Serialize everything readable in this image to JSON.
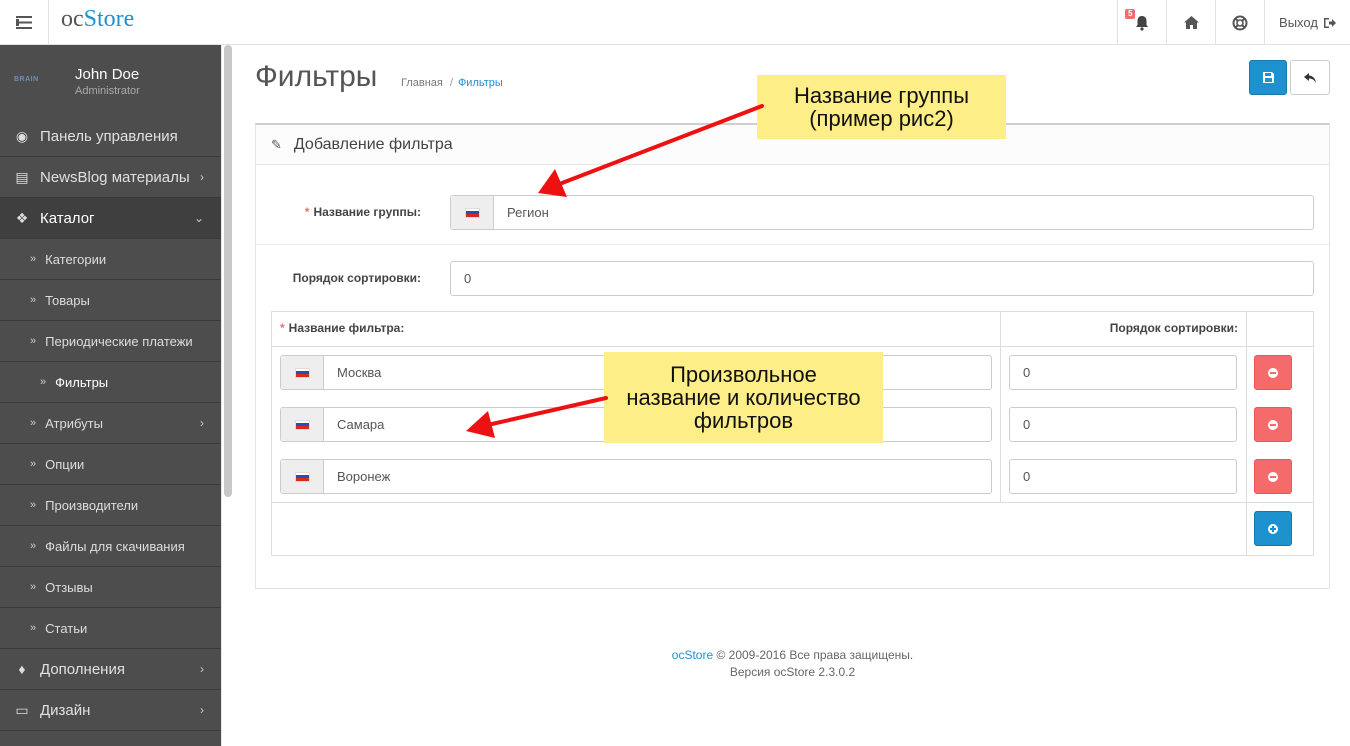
{
  "header": {
    "logo_oc": "oc",
    "logo_store": "Store",
    "notification_count": "5",
    "logout_label": "Выход"
  },
  "sidebar": {
    "brand_mark": "BRAIN",
    "user_name": "John Doe",
    "user_role": "Administrator",
    "items": [
      {
        "label": "Панель управления",
        "icon": "dashboard-icon"
      },
      {
        "label": "NewsBlog материалы",
        "icon": "newspaper-icon"
      },
      {
        "label": "Каталог",
        "icon": "tags-icon"
      },
      {
        "label": "Категории"
      },
      {
        "label": "Товары"
      },
      {
        "label": "Периодические платежи"
      },
      {
        "label": "Фильтры"
      },
      {
        "label": "Атрибуты"
      },
      {
        "label": "Опции"
      },
      {
        "label": "Производители"
      },
      {
        "label": "Файлы для скачивания"
      },
      {
        "label": "Отзывы"
      },
      {
        "label": "Статьи"
      },
      {
        "label": "Дополнения",
        "icon": "puzzle-icon"
      },
      {
        "label": "Дизайн",
        "icon": "monitor-icon"
      }
    ]
  },
  "page": {
    "title": "Фильтры",
    "breadcrumb": [
      "Главная",
      "Фильтры"
    ]
  },
  "panel": {
    "heading": "Добавление фильтра"
  },
  "form": {
    "group_name_label": "Название группы:",
    "group_name_value": "Регион",
    "sort_order_label": "Порядок сортировки:",
    "sort_order_value": "0"
  },
  "filters_table": {
    "col_name": "Название фильтра:",
    "col_sort": "Порядок сортировки:",
    "rows": [
      {
        "name": "Москва",
        "sort": "0"
      },
      {
        "name": "Самара",
        "sort": "0"
      },
      {
        "name": "Воронеж",
        "sort": "0"
      }
    ]
  },
  "footer": {
    "brand_link": "ocStore",
    "copyright": "© 2009-2016 Все права защищены.",
    "version": "Версия ocStore 2.3.0.2"
  },
  "annotations": {
    "callout_1": [
      "Название группы",
      "(пример рис2)"
    ],
    "callout_2": [
      "Произвольное",
      "название и количество",
      "фильтров"
    ],
    "arrow_color": "#ee1111",
    "callout_color": "#fdee87"
  },
  "colors": {
    "accent": "#1e91cf",
    "danger": "#f56b6b",
    "sidebar_bg": "#4d4d4d"
  }
}
